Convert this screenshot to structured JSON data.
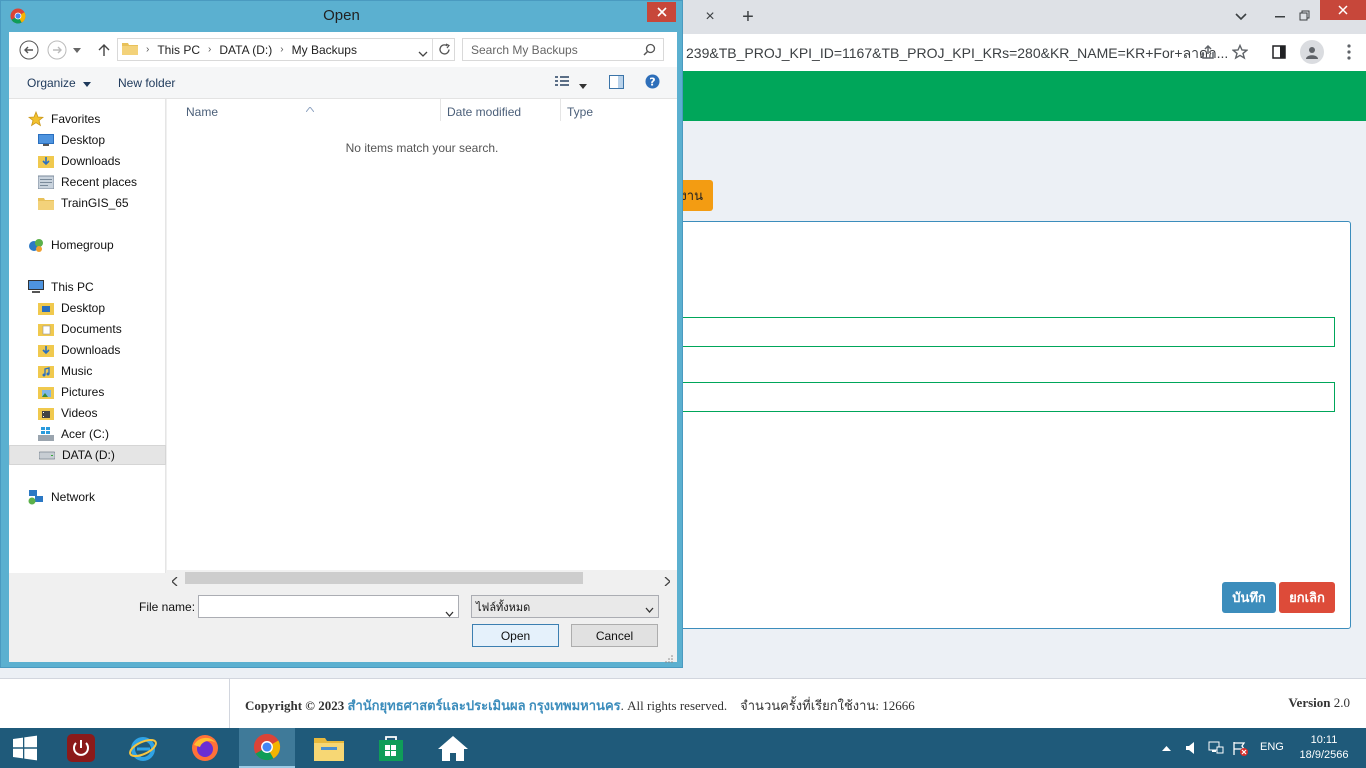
{
  "browser": {
    "url": "239&TB_PROJ_KPI_ID=1167&TB_PROJ_KPI_KRs=280&KR_NAME=KR+For+ลาดก...",
    "tab_close": "×",
    "new_tab": "+"
  },
  "page": {
    "orange_button": "งาน",
    "save_button": "บันทึก",
    "cancel_button": "ยกเลิก",
    "footer": {
      "copyright": "Copyright © 2023",
      "org": "สำนักยุทธศาสตร์และประเมินผล กรุงเทพมหานคร",
      "rights": ". All rights reserved.",
      "visits": "จำนวนครั้งที่เรียกใช้งาน: 12666",
      "version_label": "Version",
      "version_value": "2.0"
    }
  },
  "dialog": {
    "title": "Open",
    "breadcrumb": [
      "This PC",
      "DATA (D:)",
      "My Backups"
    ],
    "search_placeholder": "Search My Backups",
    "organize": "Organize",
    "new_folder": "New folder",
    "nav": {
      "favorites": "Favorites",
      "fav_items": [
        "Desktop",
        "Downloads",
        "Recent places",
        "TrainGIS_65"
      ],
      "homegroup": "Homegroup",
      "this_pc": "This PC",
      "pc_items": [
        "Desktop",
        "Documents",
        "Downloads",
        "Music",
        "Pictures",
        "Videos",
        "Acer (C:)",
        "DATA (D:)"
      ],
      "network": "Network"
    },
    "columns": [
      "Name",
      "Date modified",
      "Type"
    ],
    "empty_message": "No items match your search.",
    "file_name_label": "File name:",
    "file_name_value": "",
    "file_type": "ไฟล์ทั้งหมด",
    "open_button": "Open",
    "cancel_button": "Cancel"
  },
  "taskbar": {
    "language": "ENG",
    "time": "10:11",
    "date": "18/9/2566"
  },
  "colors": {
    "green_header": "#00a65a",
    "save_blue": "#3c8dbc",
    "cancel_red": "#dd4b39",
    "orange": "#f39c12",
    "taskbar": "#1f5a7a",
    "dialog_frame": "#5bb0d0"
  }
}
